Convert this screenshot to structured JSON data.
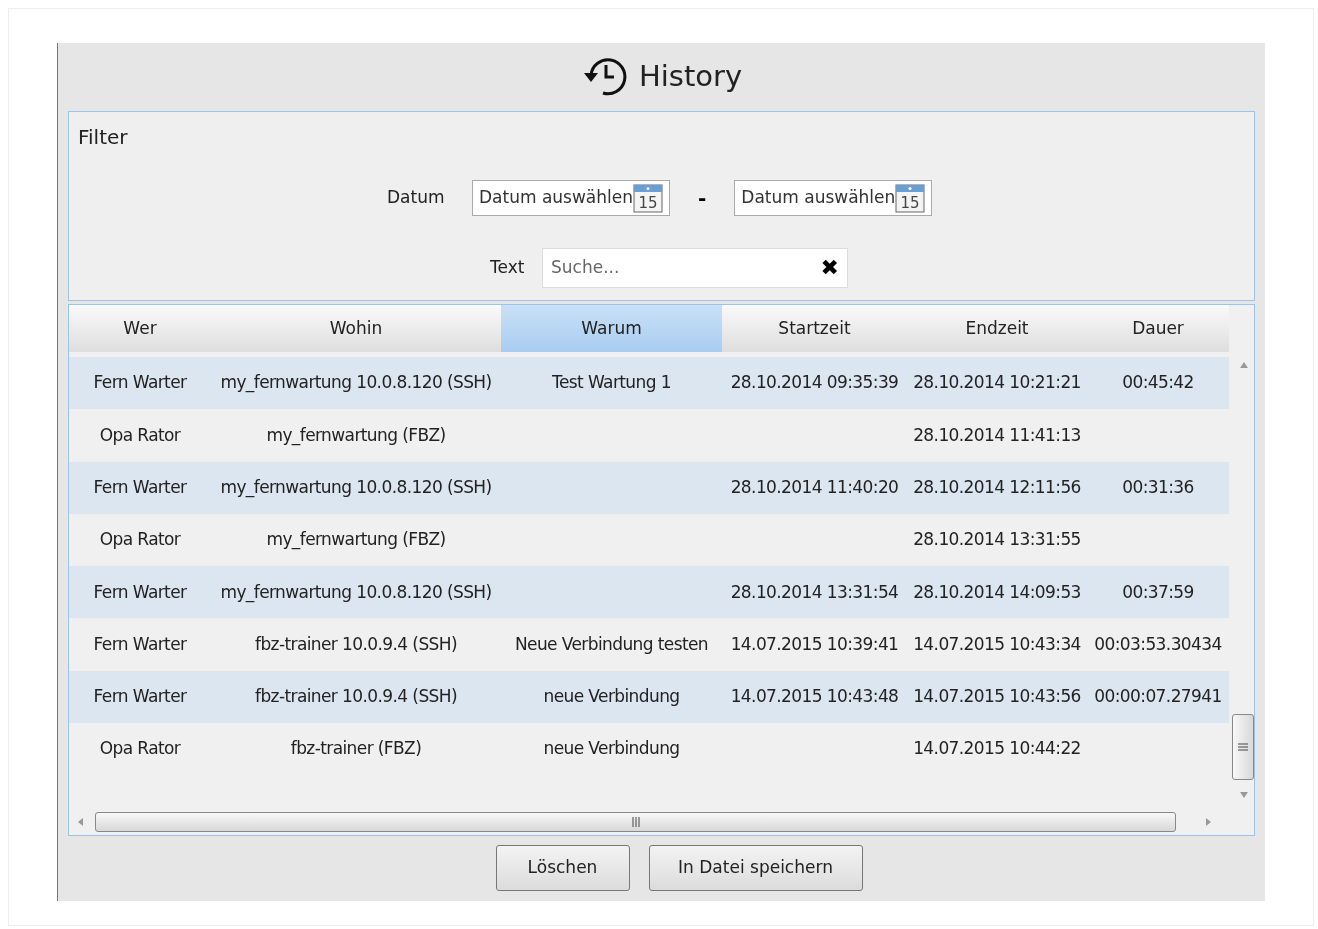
{
  "window": {
    "title": "History"
  },
  "filter": {
    "title": "Filter",
    "date_label": "Datum",
    "date_from": {
      "placeholder": "Datum auswählen",
      "icon_text": "15"
    },
    "separator": "-",
    "date_to": {
      "placeholder": "Datum auswählen",
      "icon_text": "15"
    },
    "text_label": "Text",
    "search": {
      "placeholder": "Suche...",
      "clear": "✖"
    }
  },
  "table": {
    "columns": [
      {
        "label": "Wer",
        "selected": false
      },
      {
        "label": "Wohin",
        "selected": false
      },
      {
        "label": "Warum",
        "selected": true
      },
      {
        "label": "Startzeit",
        "selected": false
      },
      {
        "label": "Endzeit",
        "selected": false
      },
      {
        "label": "Dauer",
        "selected": false
      }
    ],
    "rows": [
      [
        "Fern Warter",
        "my_fernwartung 10.0.8.120 (SSH)",
        "Test Wartung 1",
        "28.10.2014 09:35:39",
        "28.10.2014 10:21:21",
        "00:45:42"
      ],
      [
        "Opa Rator",
        "my_fernwartung (FBZ)",
        "",
        "",
        "28.10.2014 11:41:13",
        ""
      ],
      [
        "Fern Warter",
        "my_fernwartung 10.0.8.120 (SSH)",
        "",
        "28.10.2014 11:40:20",
        "28.10.2014 12:11:56",
        "00:31:36"
      ],
      [
        "Opa Rator",
        "my_fernwartung (FBZ)",
        "",
        "",
        "28.10.2014 13:31:55",
        ""
      ],
      [
        "Fern Warter",
        "my_fernwartung 10.0.8.120 (SSH)",
        "",
        "28.10.2014 13:31:54",
        "28.10.2014 14:09:53",
        "00:37:59"
      ],
      [
        "Fern Warter",
        "fbz-trainer 10.0.9.4 (SSH)",
        "Neue Verbindung testen",
        "14.07.2015 10:39:41",
        "14.07.2015 10:43:34",
        "00:03:53.30434"
      ],
      [
        "Fern Warter",
        "fbz-trainer 10.0.9.4 (SSH)",
        "neue Verbindung",
        "14.07.2015 10:43:48",
        "14.07.2015 10:43:56",
        "00:00:07.27941"
      ],
      [
        "Opa Rator",
        "fbz-trainer (FBZ)",
        "neue Verbindung",
        "",
        "14.07.2015 10:44:22",
        ""
      ]
    ]
  },
  "buttons": [
    "Löschen",
    "In Datei speichern"
  ]
}
